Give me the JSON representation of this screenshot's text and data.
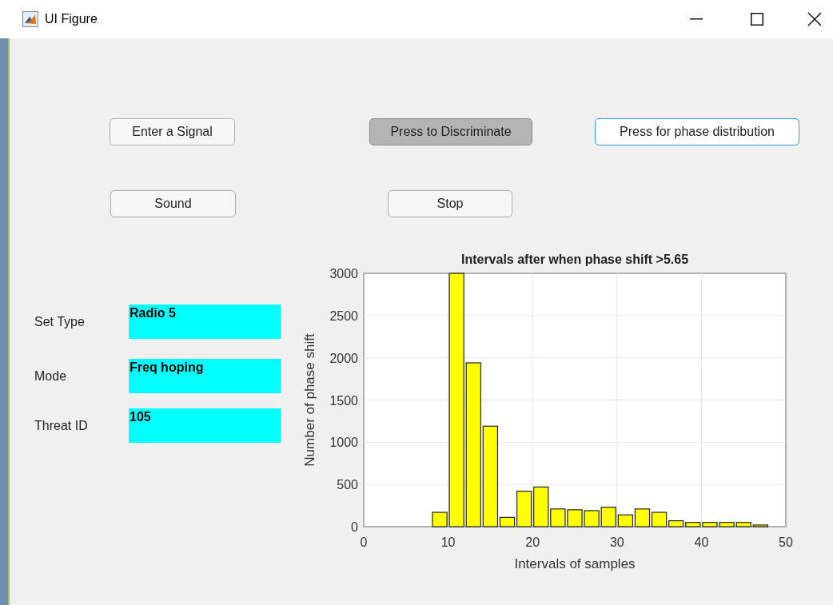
{
  "window": {
    "title": "UI Figure"
  },
  "buttons_row_1": [
    {
      "label": "Enter a Signal",
      "pressed": false,
      "focused": false
    },
    {
      "label": "Press to Discriminate",
      "pressed": true,
      "focused": false
    },
    {
      "label": "Press for phase distribution",
      "pressed": false,
      "focused": true
    }
  ],
  "buttons_row_2": [
    {
      "label": "Sound",
      "pressed": false,
      "focused": false
    },
    {
      "label": "Stop",
      "pressed": false,
      "focused": false
    }
  ],
  "fields": [
    {
      "label": "Set Type",
      "value": "Radio 5"
    },
    {
      "label": "Mode",
      "value": "Freq hoping"
    },
    {
      "label": "Threat ID",
      "value": "105"
    }
  ],
  "chart": {
    "chart_data": {
      "type": "bar",
      "title": "Intervals after when phase shift >5.65",
      "xlabel": "Intervals of samples",
      "ylabel": "Number of phase shift",
      "x": [
        9,
        11,
        13,
        15,
        17,
        19,
        21,
        23,
        25,
        27,
        29,
        31,
        33,
        35,
        37,
        39,
        41,
        43,
        45,
        47
      ],
      "series": [
        {
          "color": "#ffff00",
          "values": [
            170,
            3000,
            1940,
            1190,
            110,
            420,
            470,
            210,
            200,
            190,
            230,
            140,
            210,
            170,
            70,
            50,
            50,
            50,
            50,
            20
          ]
        }
      ],
      "grid": true,
      "xlim": [
        0,
        50
      ],
      "ylim": [
        0,
        3000
      ],
      "xticks": [
        0,
        10,
        20,
        30,
        40,
        50
      ],
      "yticks": [
        0,
        500,
        1000,
        1500,
        2000,
        2500,
        3000
      ]
    }
  }
}
